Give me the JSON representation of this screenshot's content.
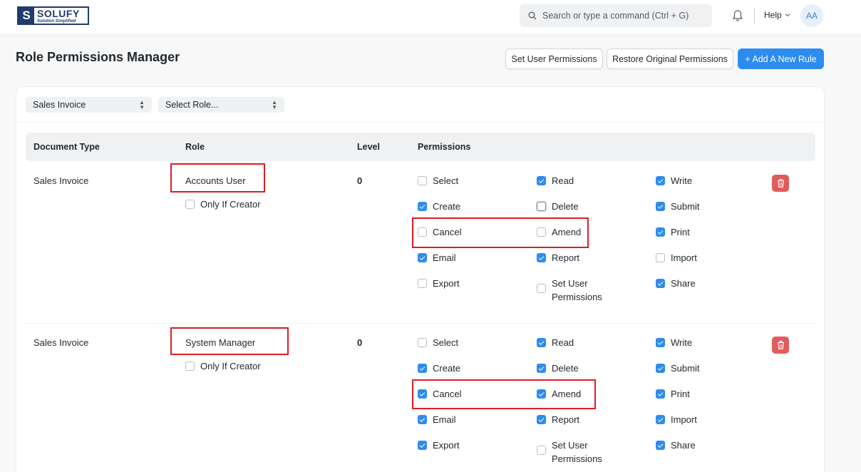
{
  "navbar": {
    "logo_name": "SOLUFY",
    "logo_tagline": "Solution Simplified",
    "search_placeholder": "Search or type a command (Ctrl + G)",
    "help_label": "Help",
    "avatar_initials": "AA"
  },
  "header": {
    "title": "Role Permissions Manager",
    "set_user_permissions": "Set User Permissions",
    "restore_original": "Restore Original Permissions",
    "add_rule": "+ Add A New Rule"
  },
  "filters": {
    "doctype": "Sales Invoice",
    "role_placeholder": "Select Role..."
  },
  "table": {
    "headers": [
      "Document Type",
      "Role",
      "Level",
      "Permissions"
    ],
    "rows": [
      {
        "doctype": "Sales Invoice",
        "role": "Accounts User",
        "only_if_creator": "Only If Creator",
        "level": "0",
        "permissions": [
          {
            "label": "Select",
            "checked": false
          },
          {
            "label": "Read",
            "checked": true
          },
          {
            "label": "Write",
            "checked": true
          },
          {
            "label": "Create",
            "checked": true
          },
          {
            "label": "Delete",
            "checked": false
          },
          {
            "label": "Submit",
            "checked": true
          },
          {
            "label": "Cancel",
            "checked": false
          },
          {
            "label": "Amend",
            "checked": false
          },
          {
            "label": "Print",
            "checked": true
          },
          {
            "label": "Email",
            "checked": true
          },
          {
            "label": "Report",
            "checked": true
          },
          {
            "label": "Import",
            "checked": false
          },
          {
            "label": "Export",
            "checked": false
          },
          {
            "label": "Set User Permissions",
            "checked": false
          },
          {
            "label": "Share",
            "checked": true
          }
        ]
      },
      {
        "doctype": "Sales Invoice",
        "role": "System Manager",
        "only_if_creator": "Only If Creator",
        "level": "0",
        "permissions": [
          {
            "label": "Select",
            "checked": false
          },
          {
            "label": "Read",
            "checked": true
          },
          {
            "label": "Write",
            "checked": true
          },
          {
            "label": "Create",
            "checked": true
          },
          {
            "label": "Delete",
            "checked": true
          },
          {
            "label": "Submit",
            "checked": true
          },
          {
            "label": "Cancel",
            "checked": true
          },
          {
            "label": "Amend",
            "checked": true
          },
          {
            "label": "Print",
            "checked": true
          },
          {
            "label": "Email",
            "checked": true
          },
          {
            "label": "Report",
            "checked": true
          },
          {
            "label": "Import",
            "checked": true
          },
          {
            "label": "Export",
            "checked": true
          },
          {
            "label": "Set User Permissions",
            "checked": false
          },
          {
            "label": "Share",
            "checked": true
          }
        ]
      }
    ]
  },
  "colors": {
    "primary": "#2d8cf0",
    "danger": "#e25c5c",
    "highlight": "#e01b24"
  }
}
